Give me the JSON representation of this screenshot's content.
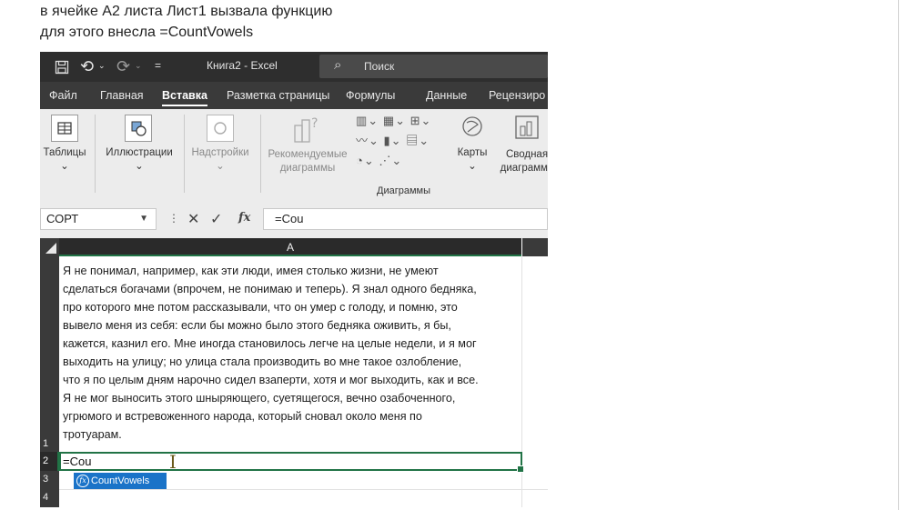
{
  "caption": {
    "line1": "в ячейке А2 листа Лист1 вызвала функцию",
    "line2": "для этого внесла  =CountVowels"
  },
  "excel": {
    "titlebar": {
      "title": "Книга2 - Excel",
      "search_placeholder": "Поиск",
      "icons": [
        "save-icon",
        "undo-icon",
        "redo-icon",
        "customize-icon",
        "search-icon"
      ]
    },
    "tabs": [
      "Файл",
      "Главная",
      "Вставка",
      "Разметка страницы",
      "Формулы",
      "Данные",
      "Рецензиро"
    ],
    "active_tab": "Вставка",
    "ribbon": {
      "tables": "Таблицы",
      "illustrations": "Иллюстрации",
      "addins": "Надстройки",
      "recommended_charts_l1": "Рекомендуемые",
      "recommended_charts_l2": "диаграммы",
      "maps": "Карты",
      "pivot_chart_l1": "Сводная",
      "pivot_chart_l2": "диаграмма",
      "charts_group": "Диаграммы"
    },
    "formula_bar": {
      "name_box": "СОРТ",
      "fx_label": "fx",
      "formula": "=Cou"
    },
    "grid": {
      "column_header": "A",
      "rows": [
        "1",
        "2",
        "3",
        "4"
      ],
      "a1_lines": [
        "Я не понимал, например, как эти люди, имея столько жизни, не умеют",
        "сделаться богачами (впрочем, не понимаю и теперь). Я знал одного бедняка,",
        "про которого мне потом рассказывали, что он умер с голоду, и помню, это",
        "вывело меня из себя: если бы можно было этого бедняка оживить, я бы,",
        "кажется, казнил его. Мне иногда становилось легче на целые недели, и я мог",
        "выходить на улицу; но улица стала производить во мне такое озлобление,",
        "что я по целым дням нарочно сидел взаперти, хотя и мог выходить, как и все.",
        "Я не мог выносить этого шныряющего, суетящегося, вечно озабоченного,",
        "угрюмого и встревоженного народа, который сновал около меня по",
        "тротуарам."
      ],
      "a2_value": "=Cou",
      "autocomplete": "CountVowels"
    }
  }
}
